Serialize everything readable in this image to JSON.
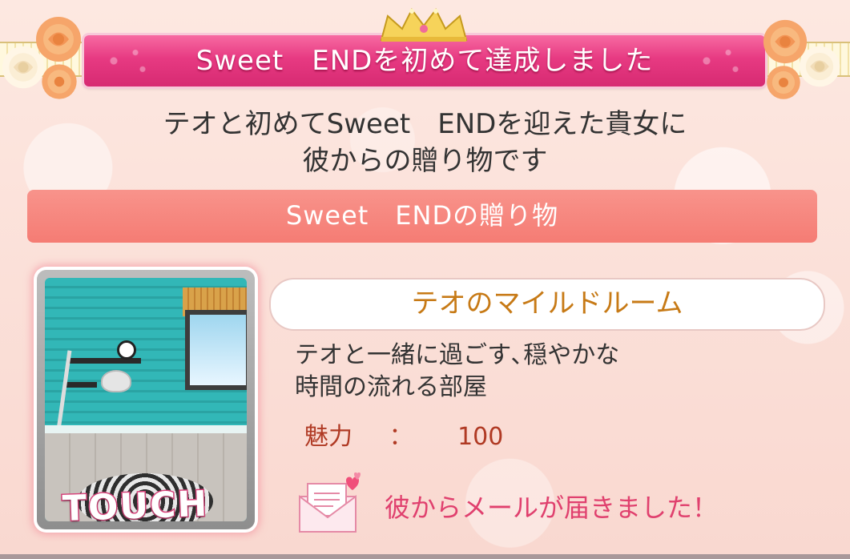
{
  "banner": {
    "title": "Sweet　ENDを初めて達成しました"
  },
  "message": {
    "line1": "テオと初めてSweet　ENDを迎えた貴女に",
    "line2": "彼からの贈り物です"
  },
  "section": {
    "title": "Sweet　ENDの贈り物"
  },
  "item": {
    "name": "テオのマイルドルーム",
    "description_line1": "テオと一緒に過ごす､穏やかな",
    "description_line2": "時間の流れる部屋",
    "stat_label": "魅力",
    "stat_separator": "：",
    "stat_value": "100",
    "thumbnail_label": "TOUCH"
  },
  "mail": {
    "notice": "彼からメールが届きました！",
    "icon": "envelope-heart-icon"
  },
  "colors": {
    "banner_pink": "#e73a82",
    "section_salmon": "#f57c74",
    "item_name_orange": "#c77a16",
    "stat_red": "#b03a24",
    "mail_pink": "#e0406e"
  }
}
